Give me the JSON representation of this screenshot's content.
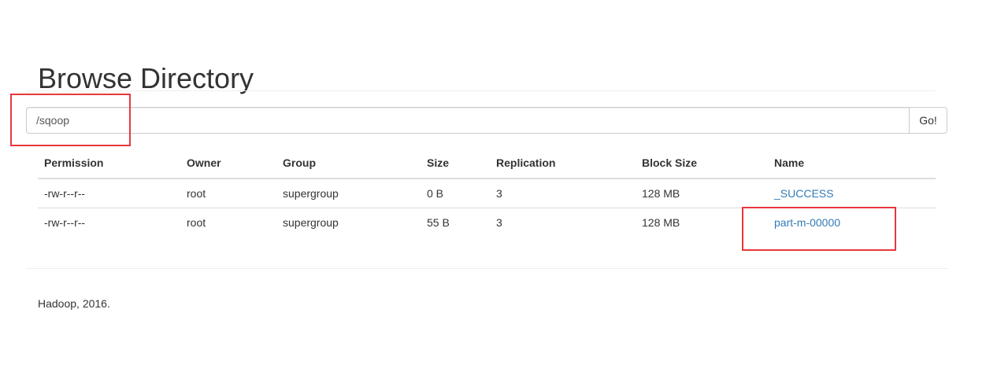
{
  "page": {
    "title": "Browse Directory"
  },
  "path_form": {
    "value": "/sqoop",
    "go_label": "Go!"
  },
  "listing": {
    "columns": [
      "Permission",
      "Owner",
      "Group",
      "Size",
      "Replication",
      "Block Size",
      "Name"
    ],
    "rows": [
      [
        "-rw-r--r--",
        "root",
        "supergroup",
        "0 B",
        "3",
        "128 MB",
        "_SUCCESS"
      ],
      [
        "-rw-r--r--",
        "root",
        "supergroup",
        "55 B",
        "3",
        "128 MB",
        "part-m-00000"
      ]
    ]
  },
  "footer": {
    "text": "Hadoop, 2016."
  },
  "colors": {
    "link": "#337ab7",
    "annotation": "#e8383d"
  }
}
